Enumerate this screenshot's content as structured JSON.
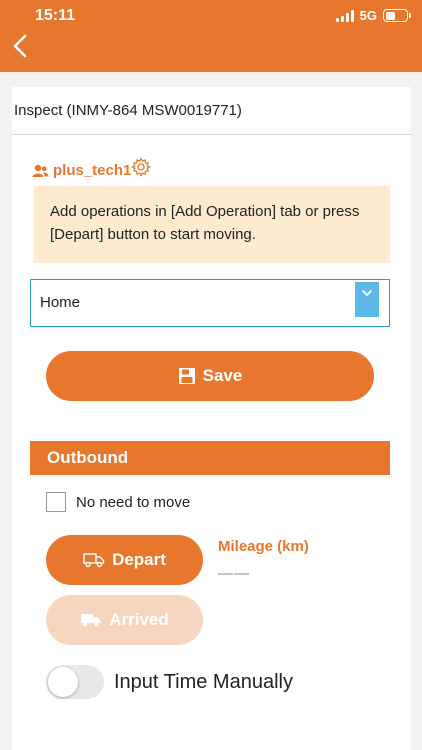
{
  "status_bar": {
    "time": "15:11",
    "network": "5G"
  },
  "header": {
    "back_icon": "chevron-left-icon"
  },
  "card": {
    "title": "Inspect  (INMY-864  MSW0019771)",
    "user": {
      "name": "plus_tech1",
      "icon": "users-icon",
      "settings_icon": "gear-icon"
    },
    "info_message": "Add operations in [Add Operation] tab or press [Depart] button to start moving.",
    "location_select": {
      "value": "Home",
      "arrow_icon": "chevron-down-icon"
    },
    "save_button": {
      "label": "Save",
      "icon": "save-icon"
    },
    "outbound": {
      "header": "Outbound",
      "no_need_to_move": {
        "label": "No need to move",
        "checked": false
      },
      "depart_button": {
        "label": "Depart",
        "icon": "truck-icon"
      },
      "arrived_button": {
        "label": "Arrived",
        "icon": "truck-icon"
      },
      "mileage": {
        "label": "Mileage (km)",
        "value": "——"
      },
      "input_time_manually": {
        "label": "Input Time Manually",
        "on": false
      }
    }
  },
  "colors": {
    "accent": "#e8772e",
    "info_bg": "#fdebd0",
    "select_border": "#2aa3c0",
    "select_arrow": "#5cb8e6",
    "disabled": "#f6d6bf"
  }
}
